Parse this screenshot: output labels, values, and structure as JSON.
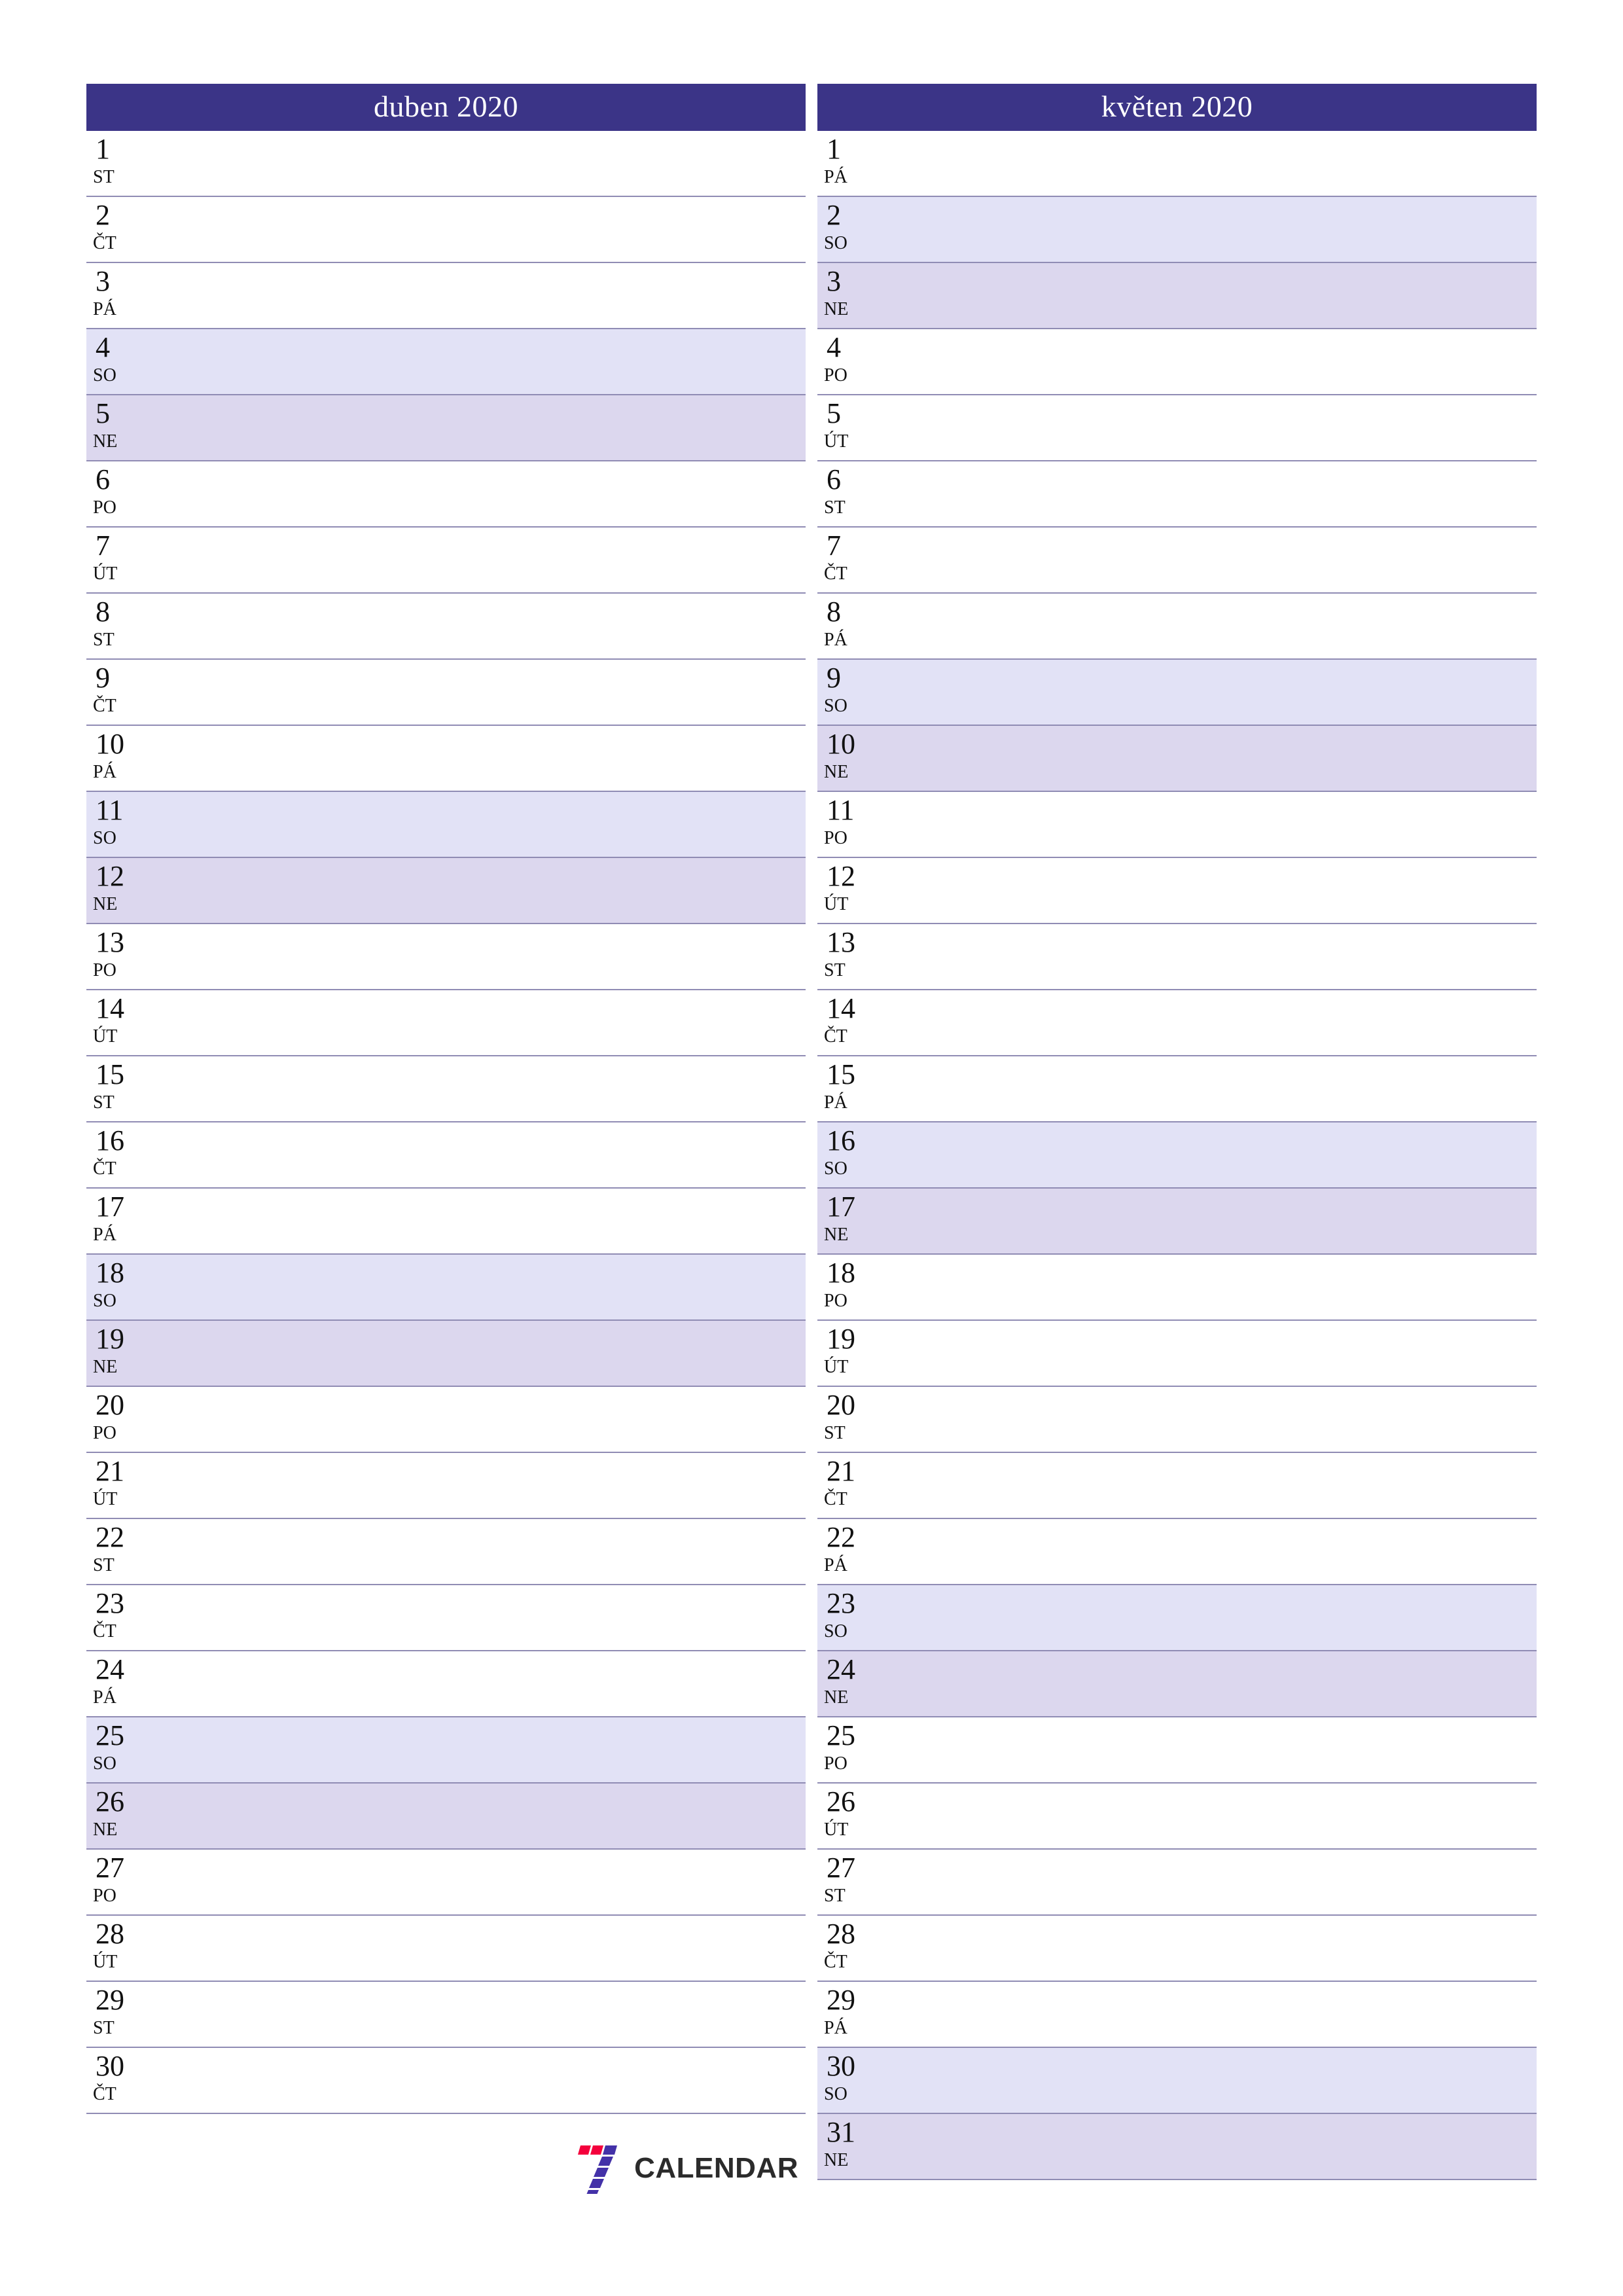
{
  "page": {
    "background": "#ffffff",
    "accent_color": "#3b3487",
    "saturday_color": "#e2e2f6",
    "sunday_color": "#dcd7ee",
    "rule_color": "#908cb4"
  },
  "footer": {
    "brand_text": "CALENDAR",
    "logo_name": "seven-calendar-logo",
    "logo_red": "#f4003c",
    "logo_blue": "#4331a8"
  },
  "months": [
    {
      "title": "duben 2020",
      "days": [
        {
          "num": "1",
          "abbr": "ST",
          "kind": "weekday"
        },
        {
          "num": "2",
          "abbr": "ČT",
          "kind": "weekday"
        },
        {
          "num": "3",
          "abbr": "PÁ",
          "kind": "weekday"
        },
        {
          "num": "4",
          "abbr": "SO",
          "kind": "sat"
        },
        {
          "num": "5",
          "abbr": "NE",
          "kind": "sun"
        },
        {
          "num": "6",
          "abbr": "PO",
          "kind": "weekday"
        },
        {
          "num": "7",
          "abbr": "ÚT",
          "kind": "weekday"
        },
        {
          "num": "8",
          "abbr": "ST",
          "kind": "weekday"
        },
        {
          "num": "9",
          "abbr": "ČT",
          "kind": "weekday"
        },
        {
          "num": "10",
          "abbr": "PÁ",
          "kind": "weekday"
        },
        {
          "num": "11",
          "abbr": "SO",
          "kind": "sat"
        },
        {
          "num": "12",
          "abbr": "NE",
          "kind": "sun"
        },
        {
          "num": "13",
          "abbr": "PO",
          "kind": "weekday"
        },
        {
          "num": "14",
          "abbr": "ÚT",
          "kind": "weekday"
        },
        {
          "num": "15",
          "abbr": "ST",
          "kind": "weekday"
        },
        {
          "num": "16",
          "abbr": "ČT",
          "kind": "weekday"
        },
        {
          "num": "17",
          "abbr": "PÁ",
          "kind": "weekday"
        },
        {
          "num": "18",
          "abbr": "SO",
          "kind": "sat"
        },
        {
          "num": "19",
          "abbr": "NE",
          "kind": "sun"
        },
        {
          "num": "20",
          "abbr": "PO",
          "kind": "weekday"
        },
        {
          "num": "21",
          "abbr": "ÚT",
          "kind": "weekday"
        },
        {
          "num": "22",
          "abbr": "ST",
          "kind": "weekday"
        },
        {
          "num": "23",
          "abbr": "ČT",
          "kind": "weekday"
        },
        {
          "num": "24",
          "abbr": "PÁ",
          "kind": "weekday"
        },
        {
          "num": "25",
          "abbr": "SO",
          "kind": "sat"
        },
        {
          "num": "26",
          "abbr": "NE",
          "kind": "sun"
        },
        {
          "num": "27",
          "abbr": "PO",
          "kind": "weekday"
        },
        {
          "num": "28",
          "abbr": "ÚT",
          "kind": "weekday"
        },
        {
          "num": "29",
          "abbr": "ST",
          "kind": "weekday"
        },
        {
          "num": "30",
          "abbr": "ČT",
          "kind": "weekday"
        }
      ]
    },
    {
      "title": "květen 2020",
      "days": [
        {
          "num": "1",
          "abbr": "PÁ",
          "kind": "weekday"
        },
        {
          "num": "2",
          "abbr": "SO",
          "kind": "sat"
        },
        {
          "num": "3",
          "abbr": "NE",
          "kind": "sun"
        },
        {
          "num": "4",
          "abbr": "PO",
          "kind": "weekday"
        },
        {
          "num": "5",
          "abbr": "ÚT",
          "kind": "weekday"
        },
        {
          "num": "6",
          "abbr": "ST",
          "kind": "weekday"
        },
        {
          "num": "7",
          "abbr": "ČT",
          "kind": "weekday"
        },
        {
          "num": "8",
          "abbr": "PÁ",
          "kind": "weekday"
        },
        {
          "num": "9",
          "abbr": "SO",
          "kind": "sat"
        },
        {
          "num": "10",
          "abbr": "NE",
          "kind": "sun"
        },
        {
          "num": "11",
          "abbr": "PO",
          "kind": "weekday"
        },
        {
          "num": "12",
          "abbr": "ÚT",
          "kind": "weekday"
        },
        {
          "num": "13",
          "abbr": "ST",
          "kind": "weekday"
        },
        {
          "num": "14",
          "abbr": "ČT",
          "kind": "weekday"
        },
        {
          "num": "15",
          "abbr": "PÁ",
          "kind": "weekday"
        },
        {
          "num": "16",
          "abbr": "SO",
          "kind": "sat"
        },
        {
          "num": "17",
          "abbr": "NE",
          "kind": "sun"
        },
        {
          "num": "18",
          "abbr": "PO",
          "kind": "weekday"
        },
        {
          "num": "19",
          "abbr": "ÚT",
          "kind": "weekday"
        },
        {
          "num": "20",
          "abbr": "ST",
          "kind": "weekday"
        },
        {
          "num": "21",
          "abbr": "ČT",
          "kind": "weekday"
        },
        {
          "num": "22",
          "abbr": "PÁ",
          "kind": "weekday"
        },
        {
          "num": "23",
          "abbr": "SO",
          "kind": "sat"
        },
        {
          "num": "24",
          "abbr": "NE",
          "kind": "sun"
        },
        {
          "num": "25",
          "abbr": "PO",
          "kind": "weekday"
        },
        {
          "num": "26",
          "abbr": "ÚT",
          "kind": "weekday"
        },
        {
          "num": "27",
          "abbr": "ST",
          "kind": "weekday"
        },
        {
          "num": "28",
          "abbr": "ČT",
          "kind": "weekday"
        },
        {
          "num": "29",
          "abbr": "PÁ",
          "kind": "weekday"
        },
        {
          "num": "30",
          "abbr": "SO",
          "kind": "sat"
        },
        {
          "num": "31",
          "abbr": "NE",
          "kind": "sun"
        }
      ]
    }
  ]
}
